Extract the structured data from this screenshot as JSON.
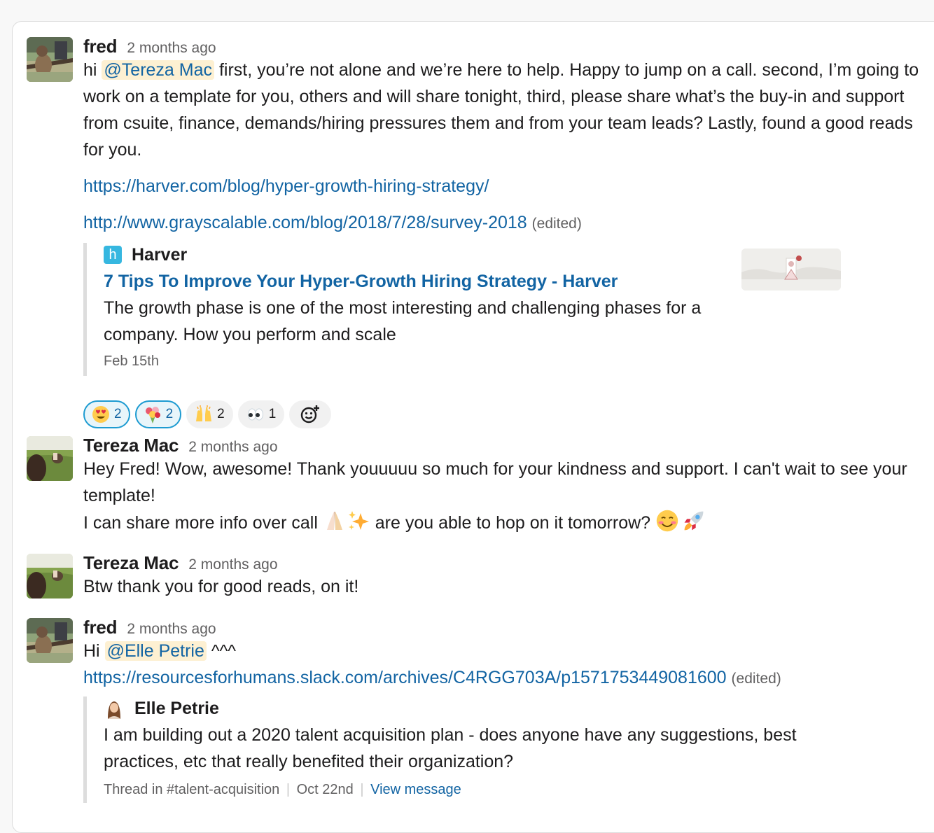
{
  "messages": [
    {
      "author": "fred",
      "time": "2 months ago",
      "text_prefix": "hi ",
      "mention": "@Tereza Mac",
      "text_rest": " first, you’re not alone and we’re here to help. Happy to jump on a call. second, I’m going to work on a template for you, others and will share tonight, third, please share what’s the buy-in and support from csuite, finance, demands/hiring pressures them and from your team leads? Lastly, found a good reads for you.",
      "link1": "https://harver.com/blog/hyper-growth-hiring-strategy/",
      "link2": "http://www.grayscalable.com/blog/2018/7/28/survey-2018",
      "edited": "(edited)",
      "unfurl": {
        "site_icon_letter": "h",
        "site": "Harver",
        "title": "7 Tips To Improve Your Hyper-Growth Hiring Strategy - Harver",
        "description": "The growth phase is one of the most interesting and challenging phases for a company. How you perform and scale",
        "date": "Feb 15th"
      },
      "reactions": [
        {
          "emoji": "heart-eyes-emoji",
          "count": "2",
          "active": true
        },
        {
          "emoji": "bouquet-emoji",
          "count": "2",
          "active": true
        },
        {
          "emoji": "raised-hands-emoji",
          "count": "2",
          "active": false
        },
        {
          "emoji": "eyes-emoji",
          "count": "1",
          "active": false
        }
      ]
    },
    {
      "author": "Tereza Mac",
      "time": "2 months ago",
      "line1": "Hey Fred! Wow, awesome! Thank youuuuu so much for your kindness and support. I can't wait to see your template!",
      "line2_a": "I can share more info over call ",
      "line2_b": " are you able to hop on it tomorrow? "
    },
    {
      "author": "Tereza Mac",
      "time": "2 months ago",
      "text": "Btw thank you for good reads, on it!"
    },
    {
      "author": "fred",
      "time": "2 months ago",
      "text_prefix": "Hi ",
      "mention": "@Elle Petrie",
      "text_rest": " ^^^",
      "link": "https://resourcesforhumans.slack.com/archives/C4RGG703A/p1571753449081600",
      "edited": "(edited)",
      "quote": {
        "author": "Elle Petrie",
        "text": "I am building out a 2020 talent acquisition plan - does anyone have any suggestions, best practices, etc that really benefited their organization?",
        "thread_in": "Thread in #talent-acquisition",
        "date": "Oct 22nd",
        "view": "View message"
      }
    }
  ],
  "colors": {
    "link": "#1264a3",
    "mention_bg": "#fdf0d2",
    "reaction_active_border": "#1d9bd1",
    "harver_icon": "#36b7e0"
  }
}
